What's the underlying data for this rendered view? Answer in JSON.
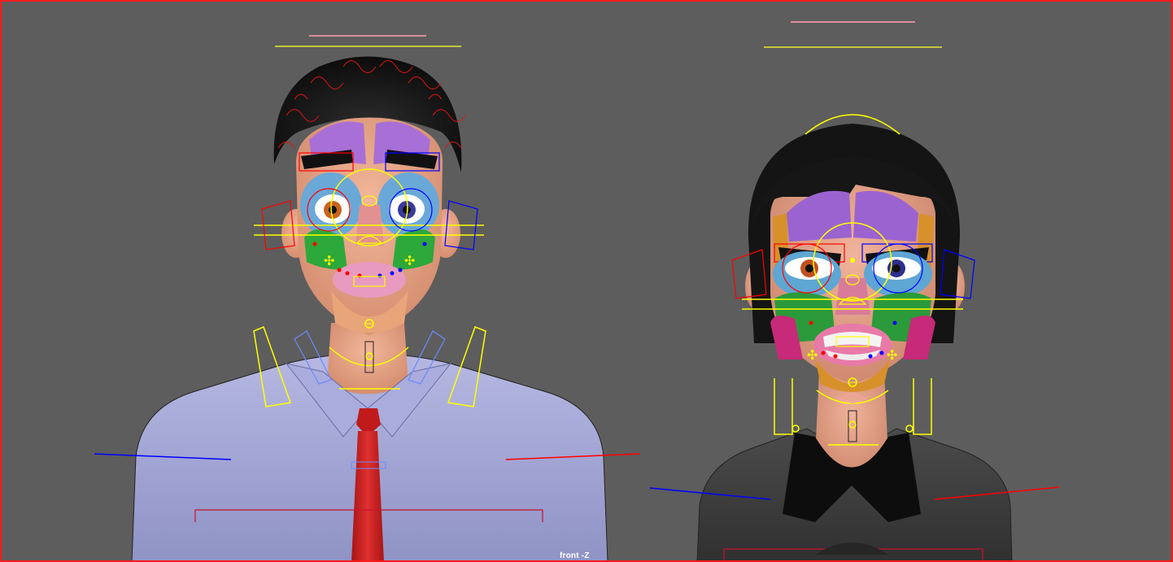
{
  "viewport": {
    "camera_label": "front -Z",
    "border_color": "#ff1a1a",
    "background_color": "#5d5d5d"
  },
  "characters": [
    {
      "name": "male-rigged-character",
      "shirt_color": "#a3a7d6",
      "tie_color": "#d12020",
      "hair_color": "#1a1a1a"
    },
    {
      "name": "female-rigged-character",
      "shirt_color": "#3e3e3e",
      "hair_color": "#151515"
    }
  ],
  "rig_colors": {
    "left_controls": "#ff0000",
    "right_controls": "#0000ff",
    "center_controls": "#ffff00",
    "secondary": "#ff9fb0"
  }
}
